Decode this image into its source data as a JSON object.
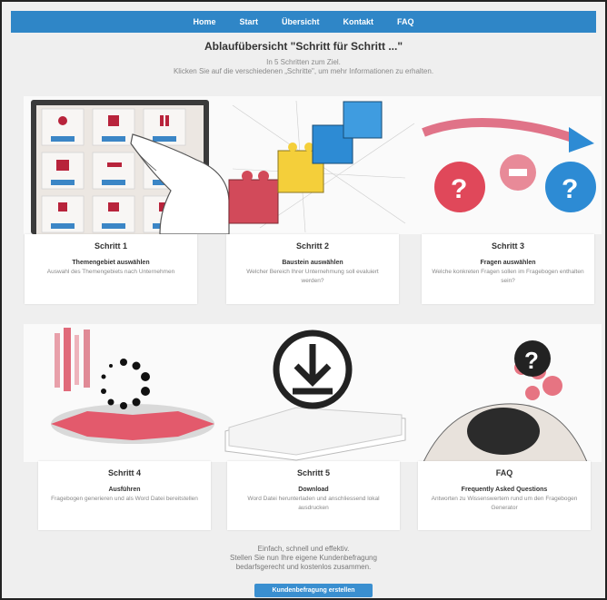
{
  "nav": {
    "items": [
      "Home",
      "Start",
      "Übersicht",
      "Kontakt",
      "FAQ"
    ]
  },
  "header": {
    "title": "Ablaufübersicht \"Schritt für Schritt ...\"",
    "subtitle_line1": "In 5 Schritten zum Ziel.",
    "subtitle_line2": "Klicken Sie auf die verschiedenen „Schritte\", um mehr Informationen zu erhalten."
  },
  "steps": [
    {
      "title": "Schritt 1",
      "heading": "Themengebiet auswählen",
      "text": "Auswahl des Themengebiets nach Unternehmen"
    },
    {
      "title": "Schritt 2",
      "heading": "Baustein auswählen",
      "text": "Welcher Bereich Ihrer Unternehmung soll evaluiert werden?"
    },
    {
      "title": "Schritt 3",
      "heading": "Fragen auswählen",
      "text": "Welche konkreten Fragen sollen im Fragebogen enthalten sein?"
    },
    {
      "title": "Schritt 4",
      "heading": "Ausführen",
      "text": "Fragebogen generieren und als Word Datei bereitstellen"
    },
    {
      "title": "Schritt 5",
      "heading": "Download",
      "text": "Word Datei herunterladen und anschliessend lokal ausdrucken"
    },
    {
      "title": "FAQ",
      "heading": "Frequently Asked Questions",
      "text": "Antworten zu Wissenswertem rund um den Fragebogen Generator"
    }
  ],
  "footer": {
    "line1": "Einfach, schnell und effektiv.",
    "line2": "Stellen Sie nun Ihre eigene Kundenbefragung",
    "line3": "bedarfsgerecht und kostenlos zusammen.",
    "cta": "Kundenbefragung erstellen"
  },
  "colors": {
    "nav": "#2f86c7",
    "accent_red": "#e0485a",
    "accent_blue": "#3a8fd0",
    "dark": "#222222"
  }
}
